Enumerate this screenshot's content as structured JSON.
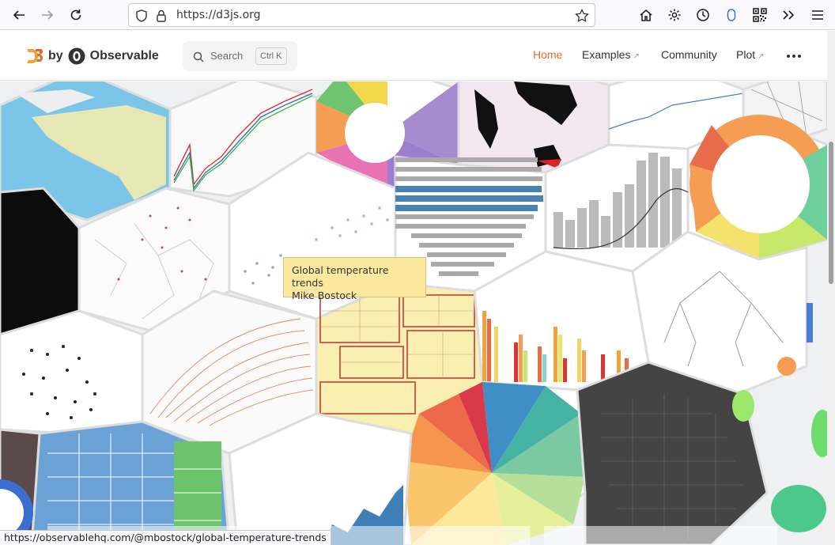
{
  "browser": {
    "url": "https://d3js.org"
  },
  "header": {
    "logo_by": "by",
    "logo_observable": "Observable",
    "search_label": "Search",
    "search_shortcut": "Ctrl K",
    "nav": [
      {
        "label": "Home",
        "active": true,
        "external": false
      },
      {
        "label": "Examples",
        "active": false,
        "external": true
      },
      {
        "label": "Community",
        "active": false,
        "external": false
      },
      {
        "label": "Plot",
        "active": false,
        "external": true
      }
    ],
    "external_glyph": "↗",
    "accent_color": "#e46d2c"
  },
  "tooltip": {
    "title": "Global temperature trends",
    "author": "Mike Bostock"
  },
  "status_bar": {
    "link": "https://observablehq.com/@mbostock/global-temperature-trends"
  },
  "icons": [
    "back-icon",
    "forward-icon",
    "reload-icon",
    "shield-icon",
    "lock-icon",
    "bookmark-star-icon",
    "home-icon",
    "gear-icon",
    "history-clock-icon",
    "container-icon",
    "qr-code-icon",
    "overflow-chevrons-icon",
    "hamburger-menu-icon",
    "search-icon",
    "more-dots-icon"
  ]
}
